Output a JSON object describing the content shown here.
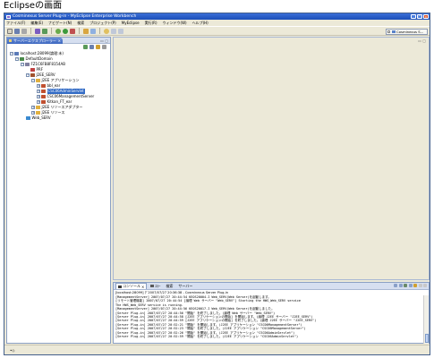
{
  "caption": "Eclipseの画面",
  "window": {
    "title": "Cosminexus Server Plug-in - MyEclipse Enterprise Workbench"
  },
  "menubar": [
    "ファイル(F)",
    "編集(E)",
    "ナビゲート(N)",
    "検索",
    "プロジェクト(P)",
    "MyEclipse",
    "実行(R)",
    "ウィンドウ(W)",
    "ヘルプ(H)"
  ],
  "toolbar": {
    "perspective_label": "Cosminexus S..."
  },
  "explorer": {
    "tab_label": "サーバーエクスプローラー",
    "tree": [
      {
        "label": "localhost:28099(論理:未)",
        "toggle": "−",
        "icon": "computer"
      },
      {
        "label": "DefaultDomain",
        "toggle": "−",
        "icon": "folder"
      },
      {
        "label": "FZ1C6FB8F8154AB",
        "toggle": "−",
        "icon": "host"
      },
      {
        "label": "PRF",
        "toggle": "",
        "icon": "prf"
      },
      {
        "label": "J2EE_SERV",
        "toggle": "−",
        "icon": "server"
      },
      {
        "label": "J2EE アプリケーション",
        "toggle": "−",
        "icon": "folder"
      },
      {
        "label": "bbl_ear",
        "toggle": "+",
        "icon": "ear"
      },
      {
        "label": "CSC06AdminServlet",
        "toggle": "+",
        "icon": "ear",
        "selected": true
      },
      {
        "label": "CSC06ManagementServer",
        "toggle": "+",
        "icon": "ear"
      },
      {
        "label": "Kitkan_FT_ear",
        "toggle": "+",
        "icon": "ear"
      },
      {
        "label": "J2EE リソースアダプター",
        "toggle": "+",
        "icon": "folder"
      },
      {
        "label": "J2EE リソース",
        "toggle": "+",
        "icon": "folder"
      },
      {
        "label": "Web_SERV",
        "toggle": "",
        "icon": "web"
      }
    ]
  },
  "console": {
    "tabs": [
      "コンソール",
      "ｴﾗｰ",
      "検索",
      "サーバー"
    ],
    "header": "[localhost:28099] ｸﾞ2007/07/27 20:36:38 - Cosminexus Server Plug-in",
    "lines": [
      "[ManagementServer] 2007/07/27 20:44:54 KEOS20004-I Web_SERV(Web Server)を起動します。",
      "[リモート管理機能] 2007/07/27 20:44:54 [論理 Web サーバー \"Web_SERV\"] Starting the HWS_Web_SERV service",
      "The HWS_Web_SERV service is running.",
      "[ManagementServer] 2007/07/27 20:44:56 KEOS20017-I Web_SERV(Web Server)を起動しました。",
      "[Server Plug-in] 2007/07/27 20:44:56 \"開始\" を終了しました。(論理 Web サーバー \"Web_SERV\")",
      "[Server Plug-in] 2007/07/27 20:44:58 [J2EE アプリケーションの開始] を開始します。(論理 J2EE サーバー \"J2EE_SERV\")",
      "[Server Plug-in] 2007/07/27 20:44:59 [J2EE アプリケーションの開始] を終了しました。(論理 J2EE サーバー \"J2EE_SERV\")",
      "[Server Plug-in] 2007/07/27 20:52:21 \"開始\" を開始します。(J2EE アプリケーション \"CSC06ManagementServer\")",
      "[Server Plug-in] 2007/07/27 20:52:23 \"開始\" を終了しました。(J2EE アプリケーション \"CSC06ManagementServer\")",
      "[Server Plug-in] 2007/07/27 20:52:26 \"開始\" を開始します。(J2EE アプリケーション \"CSC06AdminServlet\")",
      "[Server Plug-in] 2007/07/27 20:52:59 \"開始\" を終了しました。(J2EE アプリケーション \"CSC06AdminServlet\")"
    ]
  },
  "statusbar": {
    "text": "•◇"
  },
  "colors": {
    "title_bar": "#1c4fb8",
    "selection": "#316ac5",
    "chrome": "#ece9d8"
  }
}
